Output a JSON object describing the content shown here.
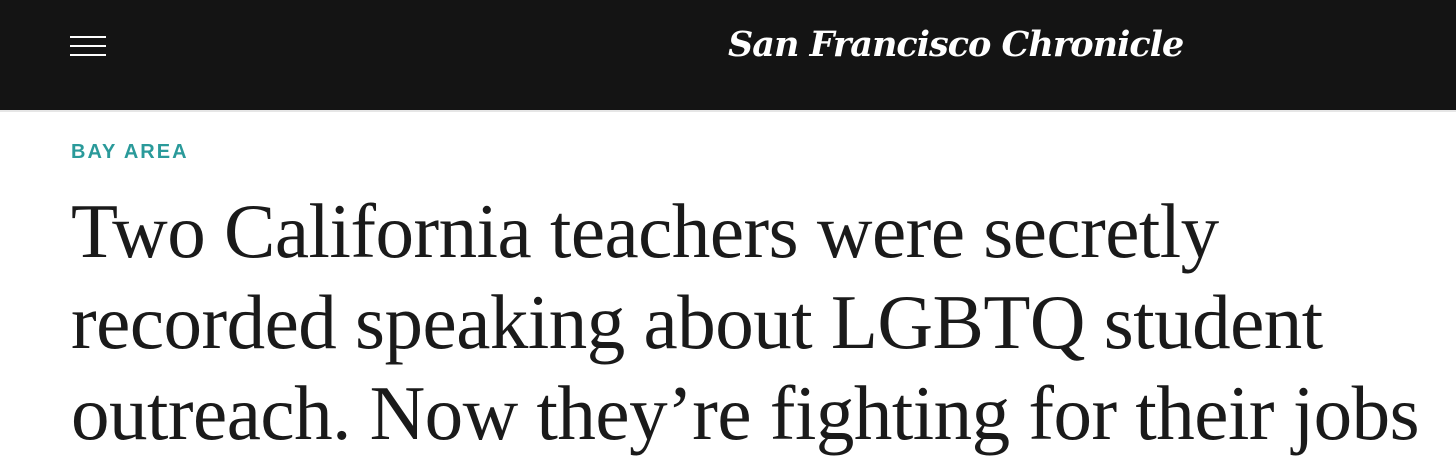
{
  "header": {
    "menu_icon": "hamburger-menu-icon",
    "logo_text": "San Francisco Chronicle",
    "background_color": "#141414"
  },
  "article": {
    "section": "BAY AREA",
    "section_color": "#2a9a9a",
    "headline": "Two California teachers were secretly recorded speaking about LGBTQ student outreach. Now they’re fighting for their jobs"
  }
}
